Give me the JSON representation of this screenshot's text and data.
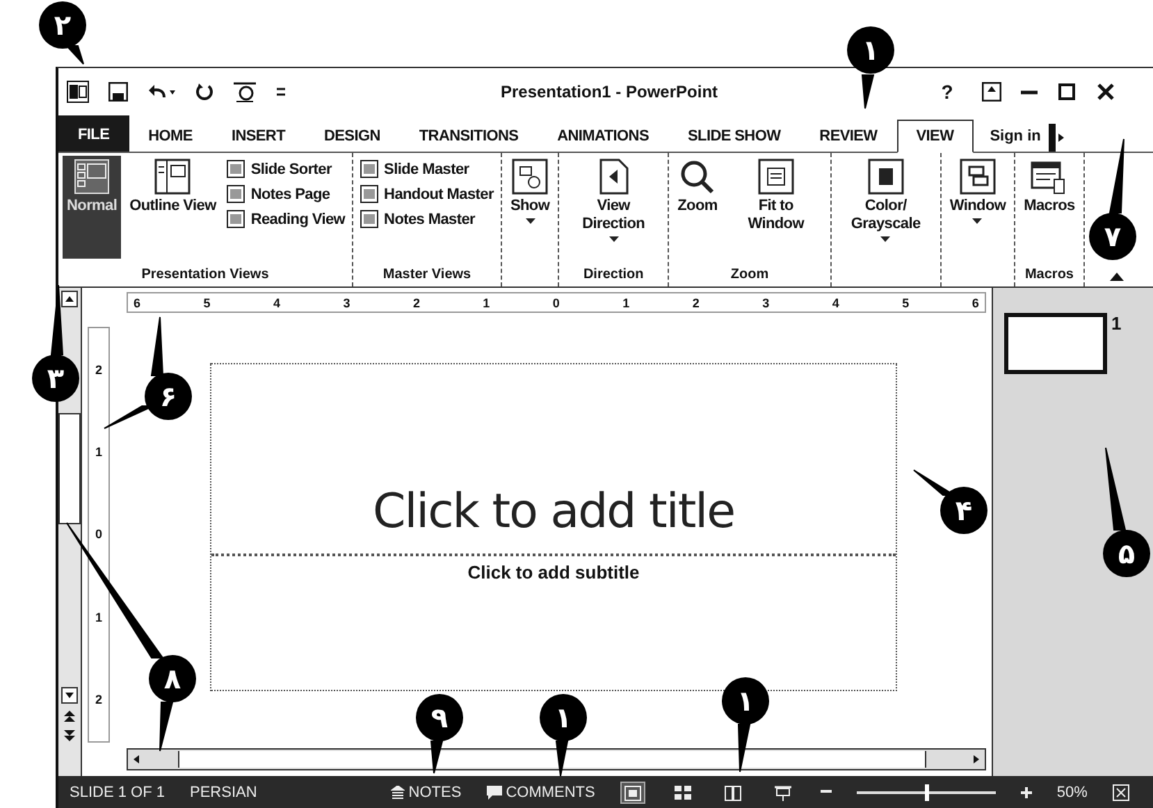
{
  "window": {
    "title": "Presentation1 - PowerPoint",
    "help": "?"
  },
  "tabs": [
    {
      "label": "FILE",
      "kind": "file",
      "selected": false
    },
    {
      "label": "HOME",
      "kind": "tab",
      "selected": false
    },
    {
      "label": "INSERT",
      "kind": "tab",
      "selected": false
    },
    {
      "label": "DESIGN",
      "kind": "tab",
      "selected": false
    },
    {
      "label": "TRANSITIONS",
      "kind": "tab",
      "selected": false
    },
    {
      "label": "ANIMATIONS",
      "kind": "tab",
      "selected": false
    },
    {
      "label": "SLIDE SHOW",
      "kind": "tab",
      "selected": false
    },
    {
      "label": "REVIEW",
      "kind": "tab",
      "selected": false
    },
    {
      "label": "VIEW",
      "kind": "tab",
      "selected": true
    }
  ],
  "sign_in": "Sign in",
  "ribbon": [
    {
      "label": "Presentation Views",
      "buttons": [
        {
          "label": "Normal",
          "kind": "large",
          "selected": true
        },
        {
          "label": "Outline View",
          "kind": "large",
          "selected": false
        },
        {
          "label": "Slide Sorter",
          "kind": "small",
          "selected": false
        },
        {
          "label": "Notes Page",
          "kind": "small",
          "selected": false
        },
        {
          "label": "Reading View",
          "kind": "small",
          "selected": false
        }
      ]
    },
    {
      "label": "Master Views",
      "buttons": [
        {
          "label": "Slide Master",
          "kind": "small",
          "selected": false
        },
        {
          "label": "Handout Master",
          "kind": "small",
          "selected": false
        },
        {
          "label": "Notes Master",
          "kind": "small",
          "selected": false
        }
      ]
    },
    {
      "buttons": [
        {
          "label": "Show",
          "kind": "menu",
          "selected": false
        }
      ]
    },
    {
      "label": "Direction",
      "buttons": [
        {
          "label": "View Direction",
          "kind": "large_menu",
          "selected": false
        }
      ]
    },
    {
      "label": "Zoom",
      "buttons": [
        {
          "label": "Zoom",
          "kind": "large",
          "selected": false
        },
        {
          "label": "Fit to Window",
          "kind": "large",
          "selected": false
        }
      ]
    },
    {
      "buttons": [
        {
          "label": "Color/ Grayscale",
          "kind": "large_menu",
          "selected": false
        }
      ]
    },
    {
      "buttons": [
        {
          "label": "Window",
          "kind": "menu",
          "selected": false
        }
      ]
    },
    {
      "label": "Macros",
      "buttons": [
        {
          "label": "Macros",
          "kind": "large",
          "selected": false
        }
      ]
    }
  ],
  "ruler": {
    "horizontal": [
      "6",
      "5",
      "4",
      "3",
      "2",
      "1",
      "0",
      "1",
      "2",
      "3",
      "4",
      "5",
      "6"
    ],
    "vertical": [
      "2",
      "1",
      "0",
      "1",
      "2"
    ]
  },
  "slide": {
    "title_placeholder": "Click to add title",
    "subtitle_placeholder": "Click to add subtitle"
  },
  "thumbnails": [
    {
      "number": "1",
      "selected": true
    }
  ],
  "status_bar": {
    "slide": "SLIDE 1 OF 1",
    "language": "PERSIAN",
    "notes": "NOTES",
    "comments": "COMMENTS",
    "views": [
      {
        "kind": "normal",
        "selected": true
      },
      {
        "kind": "sorter",
        "selected": false
      },
      {
        "kind": "reading",
        "selected": false
      },
      {
        "kind": "show",
        "selected": false
      }
    ],
    "zoom": {
      "level": 0.5,
      "reading": "50%"
    }
  },
  "callouts": [
    {
      "label": "۱"
    },
    {
      "label": "۲"
    },
    {
      "label": "۳"
    },
    {
      "label": "۶"
    },
    {
      "label": "۴"
    },
    {
      "label": "۵"
    },
    {
      "label": "۷"
    },
    {
      "label": "۸"
    },
    {
      "label": "۹"
    },
    {
      "label": "۱"
    },
    {
      "label": "۱"
    }
  ]
}
